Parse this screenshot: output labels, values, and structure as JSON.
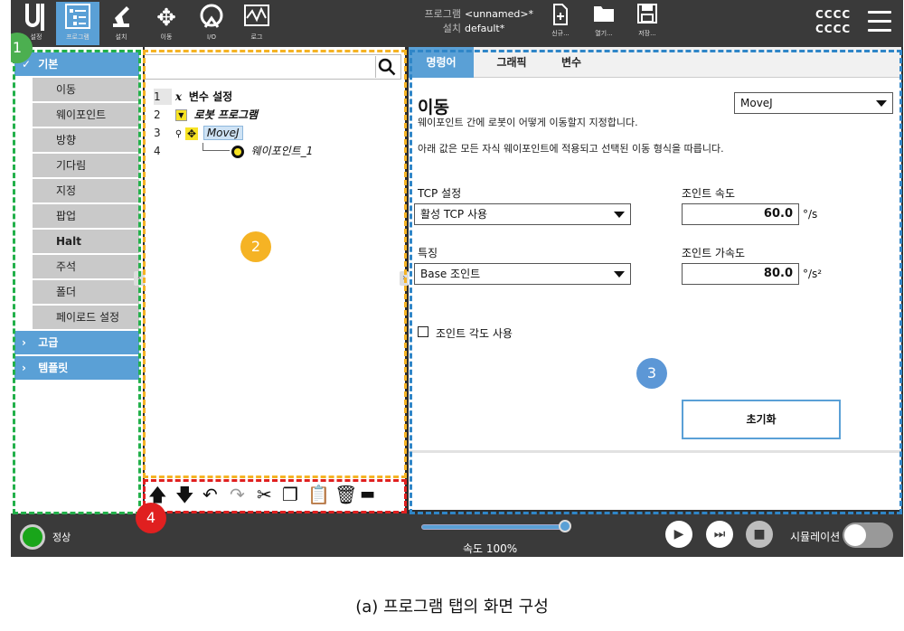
{
  "topbar": {
    "nav": [
      {
        "label": "설정",
        "icon": "ur-logo-icon"
      },
      {
        "label": "프로그램",
        "icon": "program-icon",
        "active": true
      },
      {
        "label": "설치",
        "icon": "robot-arm-icon"
      },
      {
        "label": "이동",
        "icon": "move-arrows-icon"
      },
      {
        "label": "I/O",
        "icon": "io-icon"
      },
      {
        "label": "로그",
        "icon": "log-icon"
      }
    ],
    "program_key": "프로그램",
    "program_value": "<unnamed>*",
    "install_key": "설치",
    "install_value": "default*",
    "file_buttons": [
      {
        "label": "신규...",
        "icon": "new-file-icon"
      },
      {
        "label": "열기...",
        "icon": "open-folder-icon"
      },
      {
        "label": "저장...",
        "icon": "save-icon"
      }
    ],
    "id_line1": "CCCC",
    "id_line2": "CCCC"
  },
  "left_panel": {
    "basic_label": "기본",
    "basic_items": [
      "이동",
      "웨이포인트",
      "방향",
      "기다림",
      "지정",
      "팝업",
      "Halt",
      "주석",
      "폴더",
      "페이로드 설정"
    ],
    "advanced_label": "고급",
    "template_label": "템플릿"
  },
  "tree": {
    "rows": [
      {
        "num": "1",
        "label": "변수 설정"
      },
      {
        "num": "2",
        "label": "로봇 프로그램"
      },
      {
        "num": "3",
        "label": "MoveJ"
      },
      {
        "num": "4",
        "label": "웨이포인트_1"
      }
    ]
  },
  "right_panel": {
    "tabs": [
      "명령어",
      "그래픽",
      "변수"
    ],
    "title": "이동",
    "move_type": "MoveJ",
    "desc1": "웨이포인트 간에 로봇이 어떻게 이동할지 지정합니다.",
    "desc2": "아래 값은 모든 자식 웨이포인트에 적용되고 선택된 이동 형식을 따릅니다.",
    "tcp_label": "TCP 설정",
    "tcp_value": "활성 TCP 사용",
    "feature_label": "특징",
    "feature_value": "Base 조인트",
    "joint_speed_label": "조인트 속도",
    "joint_speed_value": "60.0",
    "joint_speed_unit": "°/s",
    "joint_accel_label": "조인트 가속도",
    "joint_accel_value": "80.0",
    "joint_accel_unit": "°/s²",
    "joint_angle_checkbox": "조인트 각도 사용",
    "reset_label": "초기화"
  },
  "bottombar": {
    "status": "정상",
    "speed_text": "속도 100%",
    "speed_percent": 100,
    "simulation_label": "시뮬레이션"
  },
  "annotations": {
    "badge1": "1",
    "badge2": "2",
    "badge3": "3",
    "badge4": "4",
    "colors": {
      "green": "#22b04a",
      "yellow": "#f5b324",
      "blue": "#2f86c8",
      "red": "#e02020"
    }
  },
  "caption": "(a) 프로그램 탭의 화면 구성"
}
